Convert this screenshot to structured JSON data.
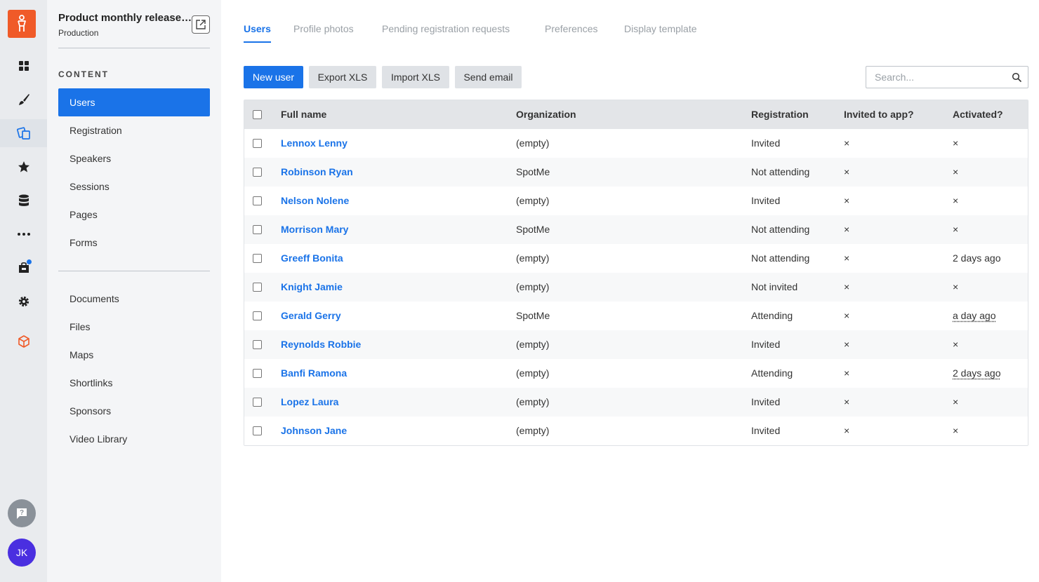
{
  "project": {
    "title": "Product monthly release tr...",
    "environment": "Production"
  },
  "sidebar": {
    "section_label": "CONTENT",
    "content_items": [
      {
        "label": "Users"
      },
      {
        "label": "Registration"
      },
      {
        "label": "Speakers"
      },
      {
        "label": "Sessions"
      },
      {
        "label": "Pages"
      },
      {
        "label": "Forms"
      }
    ],
    "other_items": [
      {
        "label": "Documents"
      },
      {
        "label": "Files"
      },
      {
        "label": "Maps"
      },
      {
        "label": "Shortlinks"
      },
      {
        "label": "Sponsors"
      },
      {
        "label": "Video Library"
      }
    ],
    "active_item": "Users"
  },
  "user": {
    "initials": "JK"
  },
  "colors": {
    "accent": "#1a73e8",
    "brand": "#f05a28",
    "avatar": "#4a2fe0"
  },
  "tabs": [
    {
      "label": "Users"
    },
    {
      "label": "Profile photos"
    },
    {
      "label": "Pending registration requests"
    },
    {
      "label": "Preferences"
    },
    {
      "label": "Display template"
    }
  ],
  "active_tab": "Users",
  "toolbar": {
    "new_user": "New user",
    "export_xls": "Export XLS",
    "import_xls": "Import XLS",
    "send_email": "Send email"
  },
  "search": {
    "placeholder": "Search..."
  },
  "table": {
    "columns": [
      "Full name",
      "Organization",
      "Registration",
      "Invited to app?",
      "Activated?"
    ],
    "rows": [
      {
        "name": "Lennox Lenny",
        "organization": "(empty)",
        "registration": "Invited",
        "invited": "×",
        "activated": "×"
      },
      {
        "name": "Robinson Ryan",
        "organization": "SpotMe",
        "registration": "Not attending",
        "invited": "×",
        "activated": "×"
      },
      {
        "name": "Nelson Nolene",
        "organization": "(empty)",
        "registration": "Invited",
        "invited": "×",
        "activated": "×"
      },
      {
        "name": "Morrison Mary",
        "organization": "SpotMe",
        "registration": "Not attending",
        "invited": "×",
        "activated": "×"
      },
      {
        "name": "Greeff Bonita",
        "organization": "(empty)",
        "registration": "Not attending",
        "invited": "×",
        "activated": "2 days ago"
      },
      {
        "name": "Knight Jamie",
        "organization": "(empty)",
        "registration": "Not invited",
        "invited": "×",
        "activated": "×"
      },
      {
        "name": "Gerald Gerry",
        "organization": "SpotMe",
        "registration": "Attending",
        "invited": "×",
        "activated": "a day ago"
      },
      {
        "name": "Reynolds Robbie",
        "organization": "(empty)",
        "registration": "Invited",
        "invited": "×",
        "activated": "×"
      },
      {
        "name": "Banfi Ramona",
        "organization": "(empty)",
        "registration": "Attending",
        "invited": "×",
        "activated": "2 days ago"
      },
      {
        "name": "Lopez Laura",
        "organization": "(empty)",
        "registration": "Invited",
        "invited": "×",
        "activated": "×"
      },
      {
        "name": "Johnson Jane",
        "organization": "(empty)",
        "registration": "Invited",
        "invited": "×",
        "activated": "×"
      }
    ]
  }
}
